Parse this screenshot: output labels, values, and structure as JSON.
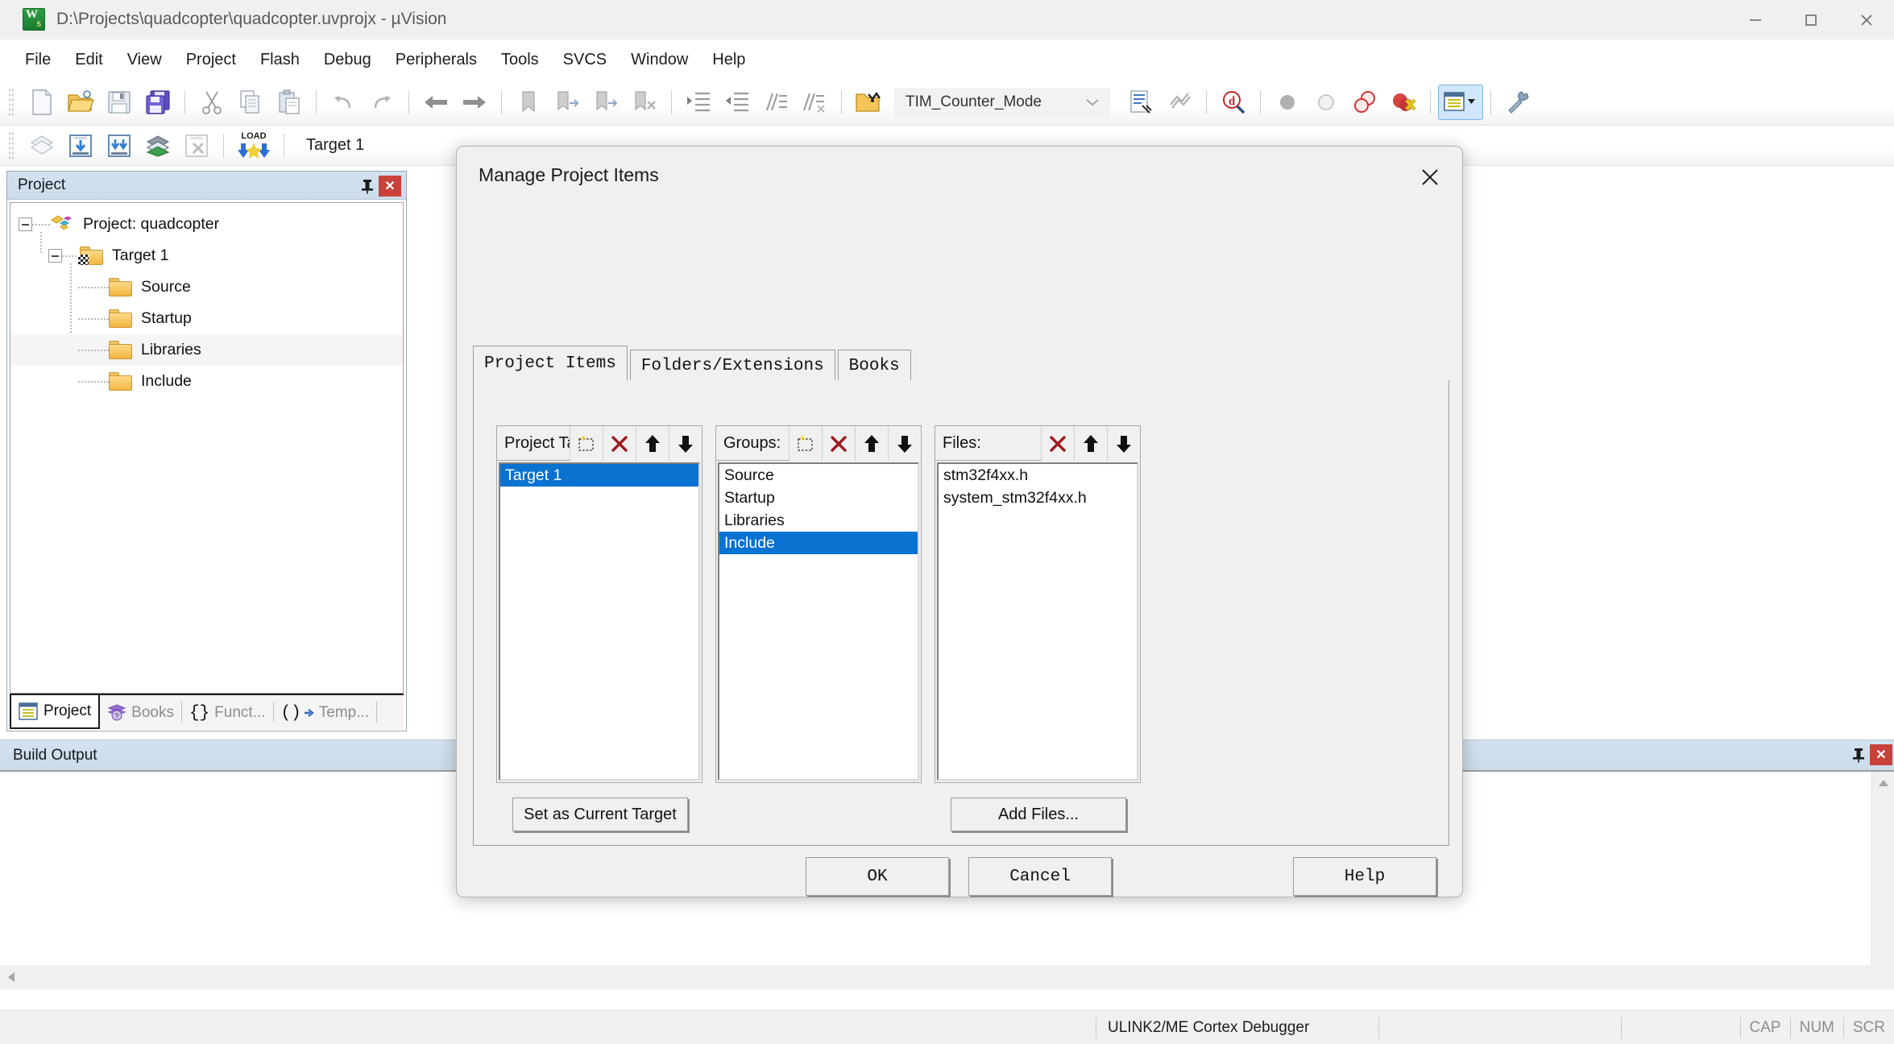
{
  "window": {
    "title": "D:\\Projects\\quadcopter\\quadcopter.uvprojx - µVision",
    "app_icon": "uvision-logo-icon",
    "controls": {
      "minimize": "minimize-icon",
      "maximize": "maximize-icon",
      "close": "close-icon"
    }
  },
  "menubar": {
    "items": [
      {
        "label": "File"
      },
      {
        "label": "Edit"
      },
      {
        "label": "View"
      },
      {
        "label": "Project"
      },
      {
        "label": "Flash"
      },
      {
        "label": "Debug"
      },
      {
        "label": "Peripherals"
      },
      {
        "label": "Tools"
      },
      {
        "label": "SVCS"
      },
      {
        "label": "Window"
      },
      {
        "label": "Help"
      }
    ]
  },
  "toolbar_main": {
    "combo_value": "TIM_Counter_Mode",
    "icons": [
      "new-file-icon",
      "open-file-icon",
      "save-icon",
      "save-all-icon",
      "cut-icon",
      "copy-icon",
      "paste-icon",
      "undo-icon",
      "redo-icon",
      "navigate-back-icon",
      "navigate-forward-icon",
      "bookmark-toggle-icon",
      "bookmark-prev-icon",
      "bookmark-next-icon",
      "bookmark-clear-icon",
      "indent-icon",
      "outdent-icon",
      "comment-icon",
      "uncomment-icon",
      "find-in-files-icon"
    ],
    "right_icons": [
      "text-browse-icon",
      "find-references-icon",
      "debug-search-icon",
      "breakpoint-insert-icon",
      "breakpoint-disable-icon",
      "breakpoint-all-icon",
      "breakpoint-kill-icon",
      "project-window-icon",
      "configure-tools-icon"
    ]
  },
  "toolbar_build": {
    "target_label": "Target 1",
    "icons": [
      "translate-file-icon",
      "build-target-icon",
      "rebuild-all-icon",
      "batch-build-icon",
      "stop-build-icon",
      "download-icon"
    ],
    "download_text": "LOAD"
  },
  "project_panel": {
    "caption": "Project",
    "pin_icon": "pin-icon",
    "close_icon": "close-icon",
    "tree": [
      {
        "label": "Project: quadcopter",
        "icon": "project-root-icon",
        "depth": 0,
        "expander": true
      },
      {
        "label": "Target 1",
        "icon": "target-folder-icon",
        "depth": 1,
        "expander": true
      },
      {
        "label": "Source",
        "icon": "folder-icon",
        "depth": 2,
        "expander": false
      },
      {
        "label": "Startup",
        "icon": "folder-icon",
        "depth": 2,
        "expander": false
      },
      {
        "label": "Libraries",
        "icon": "folder-icon",
        "depth": 2,
        "expander": false,
        "hover": true
      },
      {
        "label": "Include",
        "icon": "folder-icon",
        "depth": 2,
        "expander": false
      }
    ],
    "tabs": [
      {
        "label": "Project",
        "icon": "project-view-icon",
        "active": true
      },
      {
        "label": "Books",
        "icon": "books-icon",
        "active": false
      },
      {
        "label": "Funct...",
        "icon": "functions-icon",
        "active": false
      },
      {
        "label": "Temp...",
        "icon": "templates-icon",
        "active": false
      }
    ]
  },
  "build_output": {
    "caption": "Build Output",
    "pin_icon": "pin-icon",
    "close_icon": "close-icon",
    "text": ""
  },
  "statusbar": {
    "debugger": "ULINK2/ME Cortex Debugger",
    "keys": [
      "CAP",
      "NUM",
      "SCR"
    ]
  },
  "dialog": {
    "title": "Manage Project Items",
    "close_icon": "close-icon",
    "tabs": [
      {
        "label": "Project Items",
        "active": true
      },
      {
        "label": "Folders/Extensions",
        "active": false
      },
      {
        "label": "Books",
        "active": false
      }
    ],
    "targets_panel": {
      "label": "Project Targets:",
      "tools": [
        "new-item-icon",
        "delete-icon",
        "move-up-icon",
        "move-down-icon"
      ],
      "items": [
        {
          "label": "Target 1",
          "selected": true
        }
      ]
    },
    "groups_panel": {
      "label": "Groups:",
      "tools": [
        "new-item-icon",
        "delete-icon",
        "move-up-icon",
        "move-down-icon"
      ],
      "items": [
        {
          "label": "Source",
          "selected": false
        },
        {
          "label": "Startup",
          "selected": false
        },
        {
          "label": "Libraries",
          "selected": false
        },
        {
          "label": "Include",
          "selected": true
        }
      ]
    },
    "files_panel": {
      "label": "Files:",
      "tools": [
        "delete-icon",
        "move-up-icon",
        "move-down-icon"
      ],
      "items": [
        {
          "label": "stm32f4xx.h",
          "selected": false
        },
        {
          "label": "system_stm32f4xx.h",
          "selected": false
        }
      ]
    },
    "set_current_target_label": "Set as Current Target",
    "add_files_label": "Add Files...",
    "ok_label": "OK",
    "cancel_label": "Cancel",
    "help_label": "Help"
  },
  "colors": {
    "selection_blue": "#0a72d1",
    "caption_blue": "#d3e2f0",
    "delete_red": "#9b1b20",
    "close_red": "#c8413b",
    "folder_gold": "#f0b640"
  }
}
